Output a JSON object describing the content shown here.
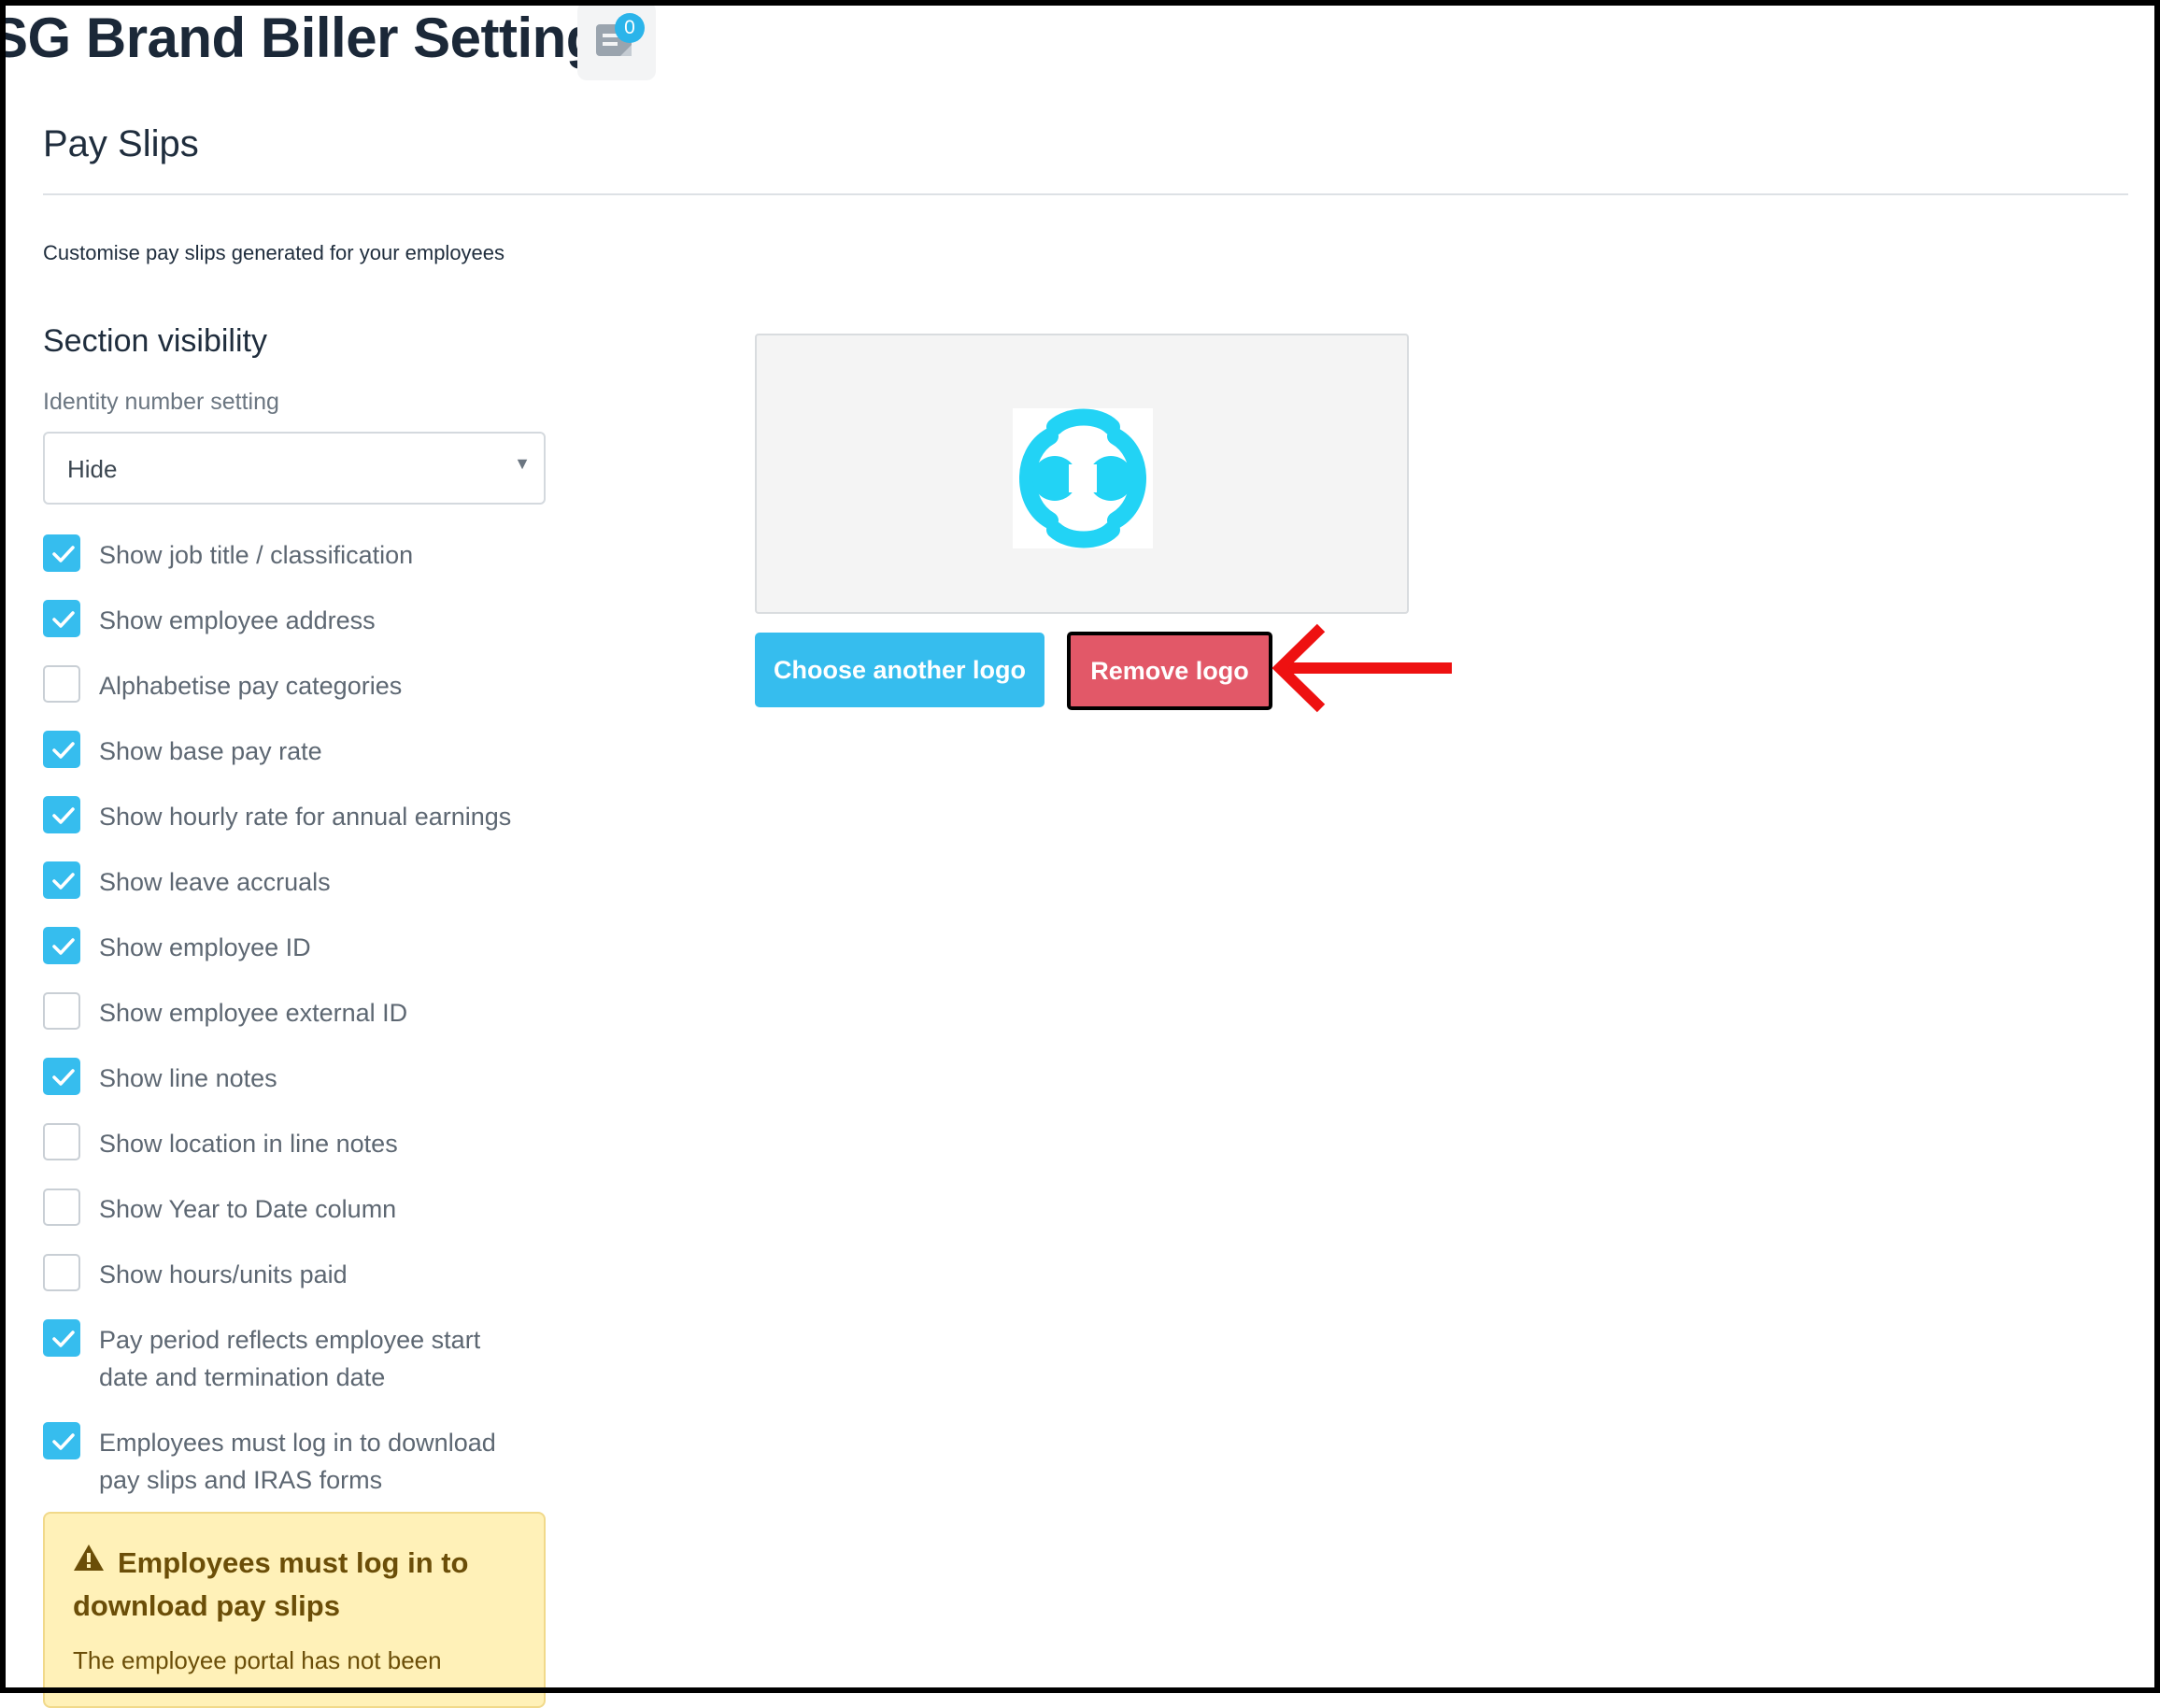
{
  "header": {
    "title": "SG Brand Biller Settings",
    "notes_badge_count": "0"
  },
  "section": {
    "title": "Pay Slips",
    "description": "Customise pay slips generated for your employees"
  },
  "visibility": {
    "heading": "Section visibility",
    "identity_label": "Identity number setting",
    "identity_value": "Hide"
  },
  "checkboxes": [
    {
      "label": "Show job title / classification",
      "checked": true
    },
    {
      "label": "Show employee address",
      "checked": true
    },
    {
      "label": "Alphabetise pay categories",
      "checked": false
    },
    {
      "label": "Show base pay rate",
      "checked": true
    },
    {
      "label": "Show hourly rate for annual earnings",
      "checked": true
    },
    {
      "label": "Show leave accruals",
      "checked": true
    },
    {
      "label": "Show employee ID",
      "checked": true
    },
    {
      "label": "Show employee external ID",
      "checked": false
    },
    {
      "label": "Show line notes",
      "checked": true
    },
    {
      "label": "Show location in line notes",
      "checked": false
    },
    {
      "label": "Show Year to Date column",
      "checked": false
    },
    {
      "label": "Show hours/units paid",
      "checked": false
    },
    {
      "label": "Pay period reflects employee start",
      "label2": "date and termination date",
      "checked": true
    },
    {
      "label": "Employees must log in to download",
      "label2": "pay slips and IRAS forms",
      "checked": true
    }
  ],
  "warning": {
    "title": "Employees must log in to download pay slips",
    "text": "The employee portal has not been"
  },
  "logo": {
    "choose_label": "Choose another logo",
    "remove_label": "Remove logo"
  },
  "colors": {
    "accent": "#36bdee",
    "danger": "#e25868",
    "warning_bg": "#fff1b8",
    "annotation": "#ee1111"
  }
}
